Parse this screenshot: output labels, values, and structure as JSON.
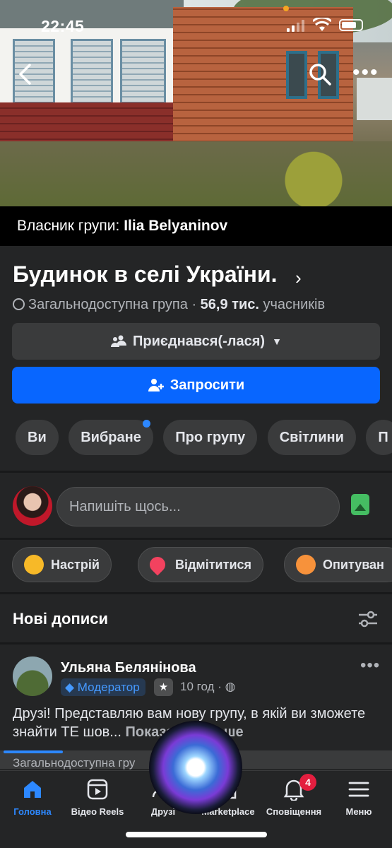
{
  "status_bar": {
    "time": "22:45"
  },
  "cover": {
    "owner_prefix": "Власник групи:",
    "owner_name": "Ilia Belyaninov"
  },
  "group": {
    "title": "Будинок в селі України.",
    "privacy": "Загальнодоступна група",
    "members_count": "56,9 тис.",
    "members_suffix": "учасників",
    "joined_label": "Приєднався(-лася)",
    "invite_label": "Запросити",
    "chips": [
      "Ви",
      "Вибране",
      "Про групу",
      "Світлини",
      "П"
    ]
  },
  "composer": {
    "placeholder": "Напишіть щось..."
  },
  "quick_actions": [
    {
      "label": "Настрій",
      "icon": "smile-icon"
    },
    {
      "label": "Відмітитися",
      "icon": "location-pin-icon"
    },
    {
      "label": "Опитуван",
      "icon": "poll-icon"
    }
  ],
  "feed": {
    "section_title": "Нові дописи",
    "post": {
      "author": "Ульяна Белянінова",
      "role_badge": "Модератор",
      "star_badge": "★",
      "time": "10 год",
      "text": "Друзі! Представляю вам нову групу, в якій ви зможете знайти ТЕ ш",
      "text_cut": "ов...",
      "show_more": "Показати більше"
    },
    "next_preview": "Загальнодоступна гру"
  },
  "tabbar": {
    "items": [
      {
        "label": "Головна",
        "icon": "home-icon",
        "active": true
      },
      {
        "label": "Відео Reels",
        "icon": "video-icon"
      },
      {
        "label": "Друзі",
        "icon": "friends-icon"
      },
      {
        "label": "Marketplace",
        "icon": "marketplace-icon"
      },
      {
        "label": "Сповіщення",
        "icon": "bell-icon",
        "badge": "4"
      },
      {
        "label": "Меню",
        "icon": "menu-icon"
      }
    ]
  },
  "colors": {
    "accent": "#0866ff",
    "background": "#242526",
    "surface": "#3a3b3c",
    "notification": "#e41e3f",
    "moderator_text": "#4599ff"
  }
}
